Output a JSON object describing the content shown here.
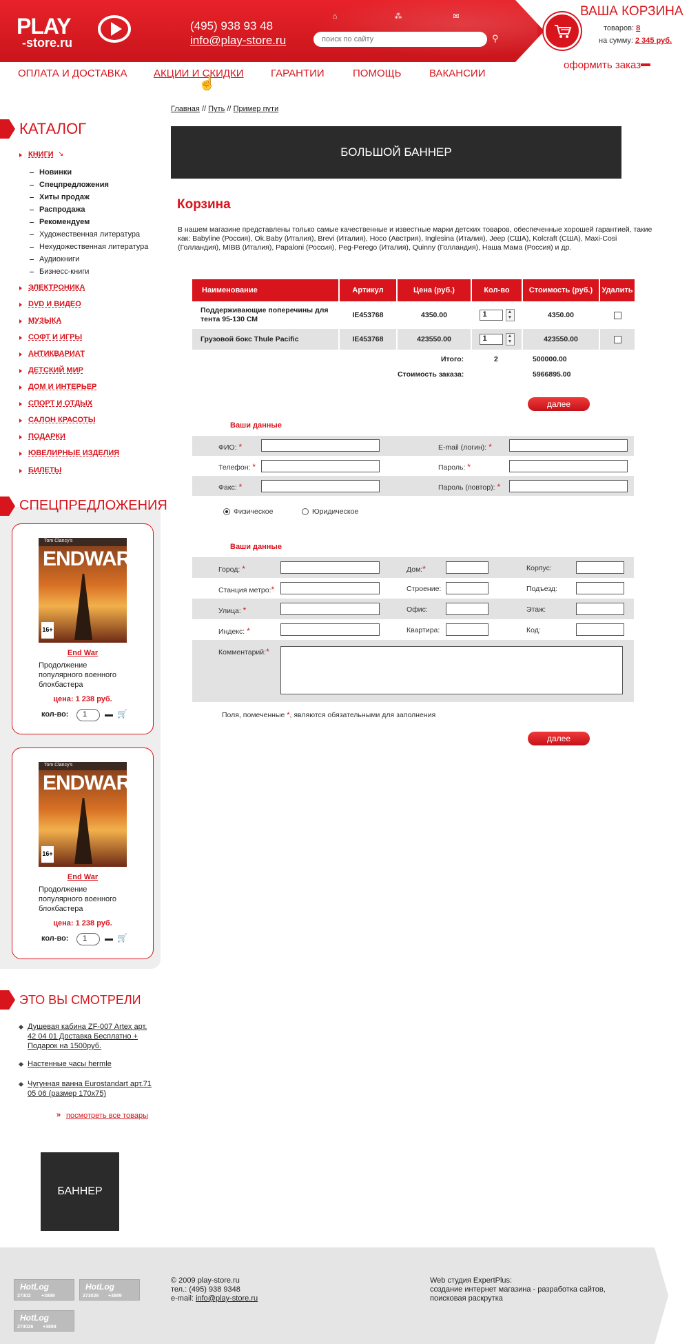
{
  "header": {
    "logo_play": "PLAY",
    "logo_store": "-store.ru",
    "phone": "(495) 938 93 48",
    "email": "info@play-store.ru",
    "search_placeholder": "поиск по сайту",
    "icons": [
      "home-icon",
      "sitemap-icon",
      "mail-icon",
      "search-icon",
      "cart-icon"
    ],
    "cart": {
      "title": "ВАША КОРЗИНА",
      "items_label": "товаров:",
      "items_value": "8",
      "sum_label": "на сумму:",
      "sum_value": "2 345 руб.",
      "order_link": "оформить заказ"
    }
  },
  "nav": [
    "ОПЛАТА И ДОСТАВКА",
    "АКЦИИ И СКИДКИ",
    "ГАРАНТИИ",
    "ПОМОЩЬ",
    "ВАКАНСИИ"
  ],
  "catalog": {
    "title": "КАТАЛОГ",
    "expanded": "КНИГИ",
    "subitems": [
      {
        "label": "Новинки",
        "bold": true
      },
      {
        "label": "Спецпредложения",
        "bold": true
      },
      {
        "label": "Хиты продаж",
        "bold": true
      },
      {
        "label": "Распродажа",
        "bold": true
      },
      {
        "label": "Рекомендуем",
        "bold": true
      },
      {
        "label": "Художественная литература",
        "bold": false
      },
      {
        "label": "Нехудожественная литература",
        "bold": false
      },
      {
        "label": "Аудиокниги",
        "bold": false
      },
      {
        "label": "Бизнесс-книги",
        "bold": false
      }
    ],
    "items": [
      "ЭЛЕКТРОНИКА",
      "DVD И ВИДЕО",
      "МУЗЫКА",
      "СОФТ И ИГРЫ",
      "АНТИКВАРИАТ",
      "ДЕТСКИЙ МИР",
      "ДОМ И ИНТЕРЬЕР",
      "СПОРТ И ОТДЫХ",
      "САЛОН КРАСОТЫ",
      "ПОДАРКИ",
      "ЮВЕЛИРНЫЕ ИЗДЕЛИЯ",
      "БИЛЕТЫ"
    ]
  },
  "specials": {
    "title": "СПЕЦПРЕДЛОЖЕНИЯ",
    "products": [
      {
        "cover_brand": "Tom Clancy's",
        "cover_title": "ENDWAR",
        "rating": "16+",
        "name": "End War",
        "desc": "Продолжение популярного военного блокбастера",
        "price": "цена: 1 238 руб.",
        "qty_label": "кол-во:",
        "qty": "1"
      },
      {
        "cover_brand": "Tom Clancy's",
        "cover_title": "ENDWAR",
        "rating": "16+",
        "name": "End War",
        "desc": "Продолжение популярного военного блокбастера",
        "price": "цена: 1 238 руб.",
        "qty_label": "кол-во:",
        "qty": "1"
      }
    ]
  },
  "seen": {
    "title": "ЭТО ВЫ СМОТРЕЛИ",
    "items": [
      "Душевая кабина ZF-007 Artex арт. 42 04 01 Доставка Бесплатно + Подарок на 1500руб.",
      "Настенные часы hermle",
      "Чугунная ванна Eurostandart арт.71 05 06 (размер 170х75)"
    ],
    "all_link": "посмотреть все товары",
    "banner": "БАННЕР"
  },
  "main": {
    "breadcrumb": [
      "Главная",
      "Путь",
      "Пример пути"
    ],
    "crumb_sep": "//",
    "banner": "БОЛЬШОЙ БАННЕР",
    "title": "Корзина",
    "intro": "В нашем магазине представлены только самые качественные и известные марки детских товаров, обеспеченные хорошей гарантией, такие как: Babyline (Россия), Ok.Baby (Италия), Brevi (Италия), Hoco (Австрия), Inglesina (Италия), Jeep (США), Kolcraft (США), Maxi-Cosi (Голландия), MIBB (Италия), Papaloni (Россия), Peg-Perego (Италия), Quinny (Голландия), Наша Мама (Россия) и др."
  },
  "cart_table": {
    "headers": [
      "Наименование",
      "Артикул",
      "Цена (руб.)",
      "Кол-во",
      "Стоимость (руб.)",
      "Удалить"
    ],
    "rows": [
      {
        "name": "Поддерживающие поперечины для тента 95-130 СМ",
        "sku": "IE453768",
        "price": "4350.00",
        "qty": "1",
        "cost": "4350.00",
        "remove": false
      },
      {
        "name": "Грузовой бокс Thule Pacific",
        "sku": "IE453768",
        "price": "423550.00",
        "qty": "1",
        "cost": "423550.00",
        "remove": false
      }
    ],
    "total_label": "Итого:",
    "total_qty": "2",
    "total_cost": "500000.00",
    "order_cost_label": "Стоимость заказа:",
    "order_cost": "5966895.00",
    "next": "далее"
  },
  "personal_form": {
    "title": "Ваши данные",
    "left": [
      "ФИО:",
      "Телефон:",
      "Факс:"
    ],
    "right": [
      "E-mail (логин):",
      "Пароль:",
      "Пароль (повтор):"
    ],
    "types": [
      "Физическое",
      "Юридическое"
    ],
    "selected": "Физическое"
  },
  "address_form": {
    "title": "Ваши данные",
    "col1": [
      "Город:",
      "Станция метро:",
      "Улица:",
      "Индекс:"
    ],
    "col2": [
      "Дом:",
      "Строение:",
      "Офис:",
      "Квартира:"
    ],
    "col3": [
      "Корпус:",
      "Подъезд:",
      "Этаж:",
      "Код:"
    ],
    "comment": "Комментарий:",
    "note_before": "Поля, помеченные ",
    "note_star": "*",
    "note_after": ", являются обязательными для заполнения",
    "next": "далее"
  },
  "footer": {
    "copyright": "© 2009 play-store.ru",
    "phone": "тел.: (495) 938 9348",
    "email_label": "e-mail: ",
    "email": "info@play-store.ru",
    "studio": "Web студия ExpertPlus:",
    "studio_desc": "создание интернет магазина - разработка сайтов, поисковая раскрутка",
    "counters": [
      {
        "brand": "HotLog",
        "left": "27302",
        "right": "+3889"
      },
      {
        "brand": "HotLog",
        "left": "273026",
        "right": "+3889"
      },
      {
        "brand": "HotLog",
        "left": "273026",
        "right": "+3889"
      }
    ]
  },
  "colors": {
    "accent": "#d8141c",
    "row_gray": "#e2e2e2",
    "banner": "#2b2b2b"
  }
}
